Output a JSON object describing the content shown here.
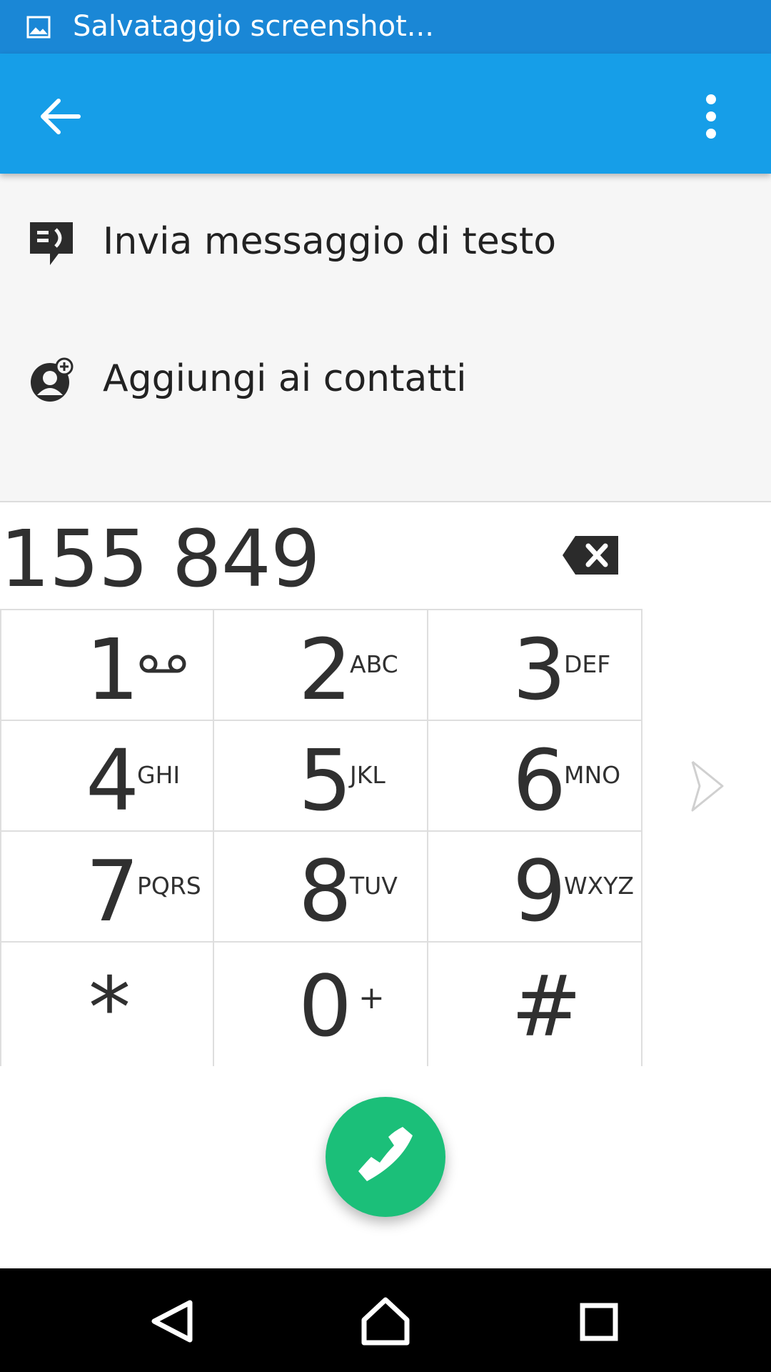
{
  "status_bar": {
    "notification_text": "Salvataggio screenshot...",
    "notification_icon": "image-icon"
  },
  "app_bar": {
    "color": "#169ee8",
    "back_icon": "arrow-left-icon",
    "overflow_icon": "more-vert-icon"
  },
  "actions": [
    {
      "label": "Invia messaggio di testo",
      "icon": "message-icon"
    },
    {
      "label": "Aggiungi ai contatti",
      "icon": "add-contact-icon"
    }
  ],
  "dialer": {
    "number": "155 849",
    "backspace_icon": "backspace-icon",
    "keys": [
      {
        "digit": "1",
        "letters": "",
        "icon": "voicemail-icon"
      },
      {
        "digit": "2",
        "letters": "ABC"
      },
      {
        "digit": "3",
        "letters": "DEF"
      },
      {
        "digit": "4",
        "letters": "GHI"
      },
      {
        "digit": "5",
        "letters": "JKL"
      },
      {
        "digit": "6",
        "letters": "MNO"
      },
      {
        "digit": "7",
        "letters": "PQRS"
      },
      {
        "digit": "8",
        "letters": "TUV"
      },
      {
        "digit": "9",
        "letters": "WXYZ"
      },
      {
        "digit": "*",
        "letters": ""
      },
      {
        "digit": "0",
        "letters": "+"
      },
      {
        "digit": "#",
        "letters": ""
      }
    ],
    "call_button_color": "#1bbf79",
    "call_icon": "phone-icon"
  },
  "nav_bar": {
    "back_icon": "nav-back-icon",
    "home_icon": "nav-home-icon",
    "recents_icon": "nav-recents-icon"
  }
}
